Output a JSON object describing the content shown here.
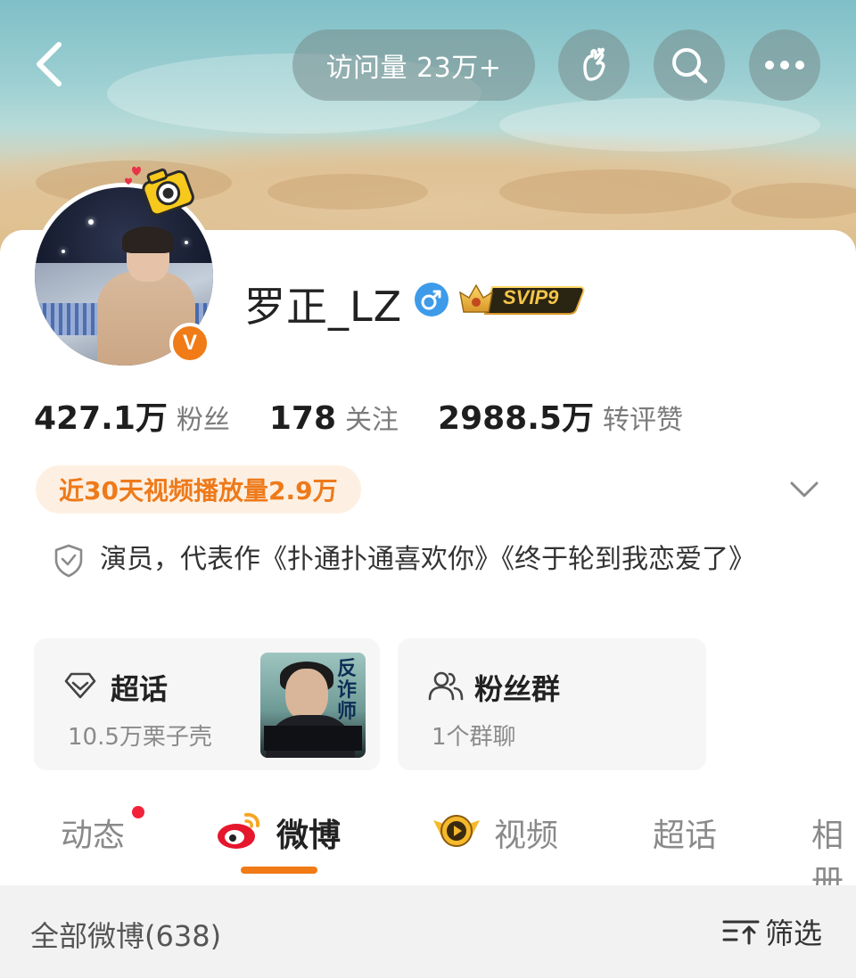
{
  "header": {
    "visits_label": "访问量 23万+",
    "icons": [
      "back-icon",
      "hand-heart-icon",
      "search-icon",
      "more-icon"
    ]
  },
  "profile": {
    "name": "罗正_LZ",
    "gender": "male",
    "vip_badge": "SVIP9",
    "verified_badge": "V",
    "stats": [
      {
        "value": "427.1万",
        "label": "粉丝"
      },
      {
        "value": "178",
        "label": "关注"
      },
      {
        "value": "2988.5万",
        "label": "转评赞"
      }
    ],
    "video_plays": "近30天视频播放量2.9万",
    "bio": "演员，代表作《扑通扑通喜欢你》《终于轮到我恋爱了》"
  },
  "tiles": {
    "chaohua": {
      "title": "超话",
      "sub": "10.5万栗子壳",
      "poster_title": "反诈师"
    },
    "fans_group": {
      "title": "粉丝群",
      "sub": "1个群聊"
    }
  },
  "tabs": [
    {
      "label": "动态",
      "active": false,
      "has_dot": true
    },
    {
      "label": "微博",
      "active": true
    },
    {
      "label": "视频",
      "active": false
    },
    {
      "label": "超话",
      "active": false
    },
    {
      "label": "相册",
      "active": false
    }
  ],
  "feed_bar": {
    "all_label": "全部微博(638)",
    "filter_label": "筛选"
  },
  "colors": {
    "accent": "#f07b17",
    "notify_dot": "#f2223a",
    "play_pill_bg": "#fdf0e3"
  }
}
